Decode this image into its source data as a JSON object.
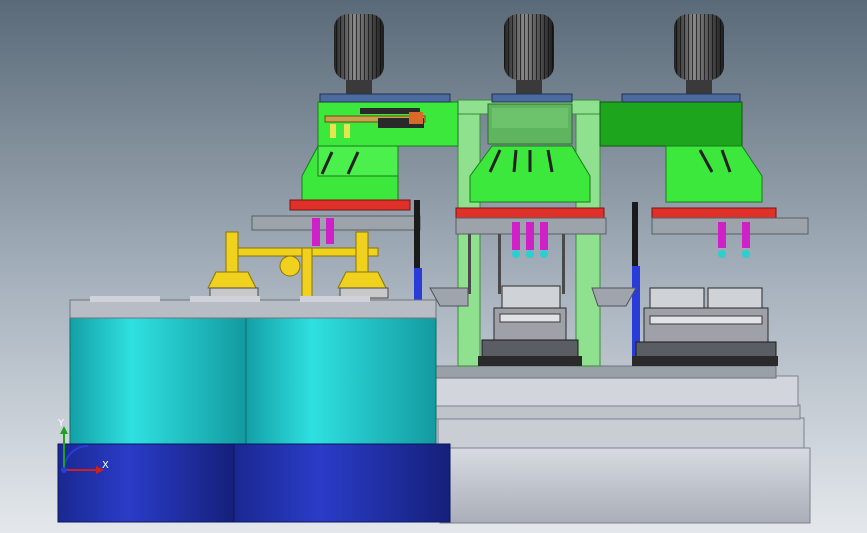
{
  "view": {
    "background_top": "#5a6a78",
    "background_bottom": "#e4e8ec"
  },
  "colors": {
    "frame_green": "#3ce83c",
    "frame_green_dark": "#1fa31f",
    "pale_green": "#8fe08f",
    "red_plate": "#e0302a",
    "teal_drum": "#22c7c7",
    "navy_base": "#1f2fa8",
    "machine_gray": "#b8bcc4",
    "magenta": "#d020c8",
    "yellow": "#f0d21e",
    "blue_rod": "#2a3cd8",
    "dark": "#1a1a1a"
  },
  "triad": {
    "x_label": "X",
    "y_label": "Y"
  }
}
